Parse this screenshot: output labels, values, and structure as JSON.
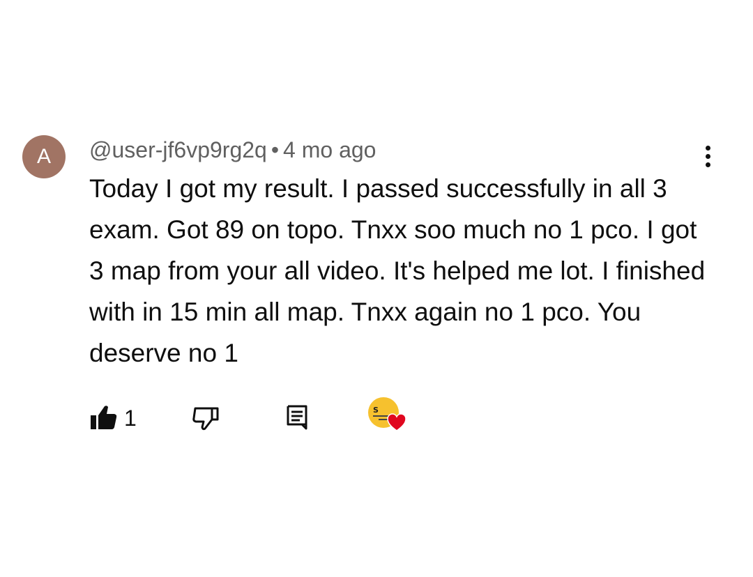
{
  "comment": {
    "avatar_letter": "A",
    "avatar_color": "#a17464",
    "handle": "@user-jf6vp9rg2q",
    "separator": "•",
    "time_ago": "4 mo ago",
    "text": "Today I got my result. I passed successfully in all 3 exam. Got 89 on topo. Tnxx soo much no 1 pco. I got 3 map from your all video. It's helped me lot. I finished with in 15 min all map. Tnxx again no 1 pco. You deserve no 1",
    "more_icon": "more-vert-icon"
  },
  "actions": {
    "like_icon": "thumbs-up-filled-icon",
    "like_count": "1",
    "dislike_icon": "thumbs-down-icon",
    "reply_icon": "reply-comment-icon",
    "creator_heart": {
      "icon": "creator-heart-icon",
      "heart_color": "#e0071f",
      "avatar_color": "#f6c12e"
    }
  }
}
